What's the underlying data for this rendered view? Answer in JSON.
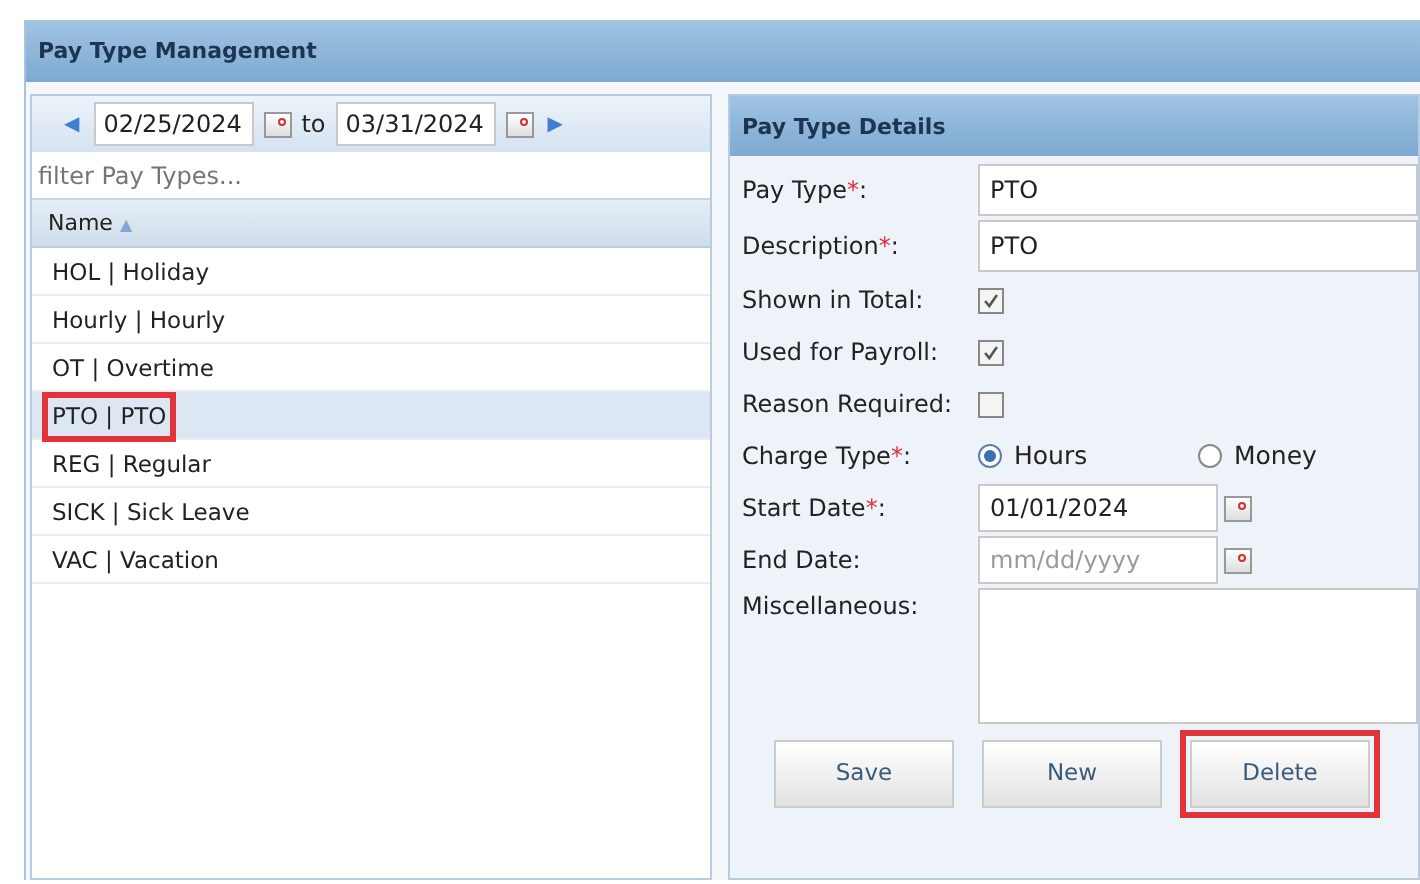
{
  "window": {
    "title": "Pay Type Management"
  },
  "date_range": {
    "prev": "◀",
    "from": "02/25/2024",
    "to_label": "to",
    "to": "03/31/2024",
    "next": "▶"
  },
  "filter": {
    "placeholder": "filter Pay Types..."
  },
  "list": {
    "column": "Name",
    "sort": "▲",
    "rows": [
      {
        "text": "HOL | Holiday",
        "selected": false,
        "callout": false
      },
      {
        "text": "Hourly | Hourly",
        "selected": false,
        "callout": false
      },
      {
        "text": "OT | Overtime",
        "selected": false,
        "callout": false
      },
      {
        "text": "PTO | PTO",
        "selected": true,
        "callout": true
      },
      {
        "text": "REG | Regular",
        "selected": false,
        "callout": false
      },
      {
        "text": "SICK | Sick Leave",
        "selected": false,
        "callout": false
      },
      {
        "text": "VAC | Vacation",
        "selected": false,
        "callout": false
      }
    ]
  },
  "details": {
    "title": "Pay Type Details",
    "fields": [
      {
        "kind": "text",
        "label": "Pay Type",
        "required_mark": "*",
        "suffix": ":",
        "value": "PTO"
      },
      {
        "kind": "text",
        "label": "Description",
        "required_mark": "*",
        "suffix": ":",
        "value": "PTO"
      },
      {
        "kind": "checkbox",
        "label": "Shown in Total:",
        "checked": true
      },
      {
        "kind": "checkbox",
        "label": "Used for Payroll:",
        "checked": true
      },
      {
        "kind": "checkbox",
        "label": "Reason Required:",
        "checked": false
      },
      {
        "kind": "radio",
        "label": "Charge Type",
        "required_mark": "*",
        "suffix": ":",
        "options": [
          {
            "text": "Hours",
            "selected": true
          },
          {
            "text": "Money",
            "selected": false
          }
        ]
      },
      {
        "kind": "date",
        "label": "Start Date",
        "required_mark": "*",
        "suffix": ":",
        "value": "01/01/2024"
      },
      {
        "kind": "date",
        "label": "End Date:",
        "placeholder": "mm/dd/yyyy"
      },
      {
        "kind": "textarea",
        "label": "Miscellaneous:"
      }
    ],
    "buttons": [
      {
        "text": "Save",
        "callout": false
      },
      {
        "text": "New",
        "callout": false
      },
      {
        "text": "Delete",
        "callout": true
      }
    ]
  }
}
